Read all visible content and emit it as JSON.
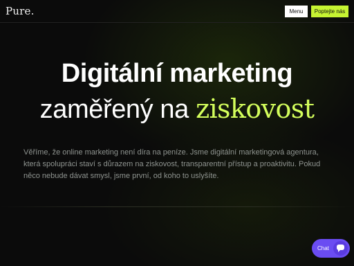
{
  "header": {
    "logo": "Pure.",
    "menu_label": "Menu",
    "cta_label": "Poptejte nás"
  },
  "hero": {
    "line1": "Digitální marketing",
    "line2_prefix": "zaměřený na ",
    "line2_accent": "ziskovost",
    "description": "Věříme, že online marketing není díra na peníze. Jsme digitální marketingová agentura, která spolupráci staví s důrazem na ziskovost, transparentní přístup a proaktivitu. Pokud něco nebude dávat smysl, jsme první, od koho to uslyšíte."
  },
  "chat": {
    "label": "Chat",
    "icon": "chat-bubble-icon"
  },
  "colors": {
    "accent": "#d4ff5c",
    "cta_bg": "#c6f432",
    "chat_bg": "#6a4cf2",
    "background": "#0b0b0b"
  }
}
